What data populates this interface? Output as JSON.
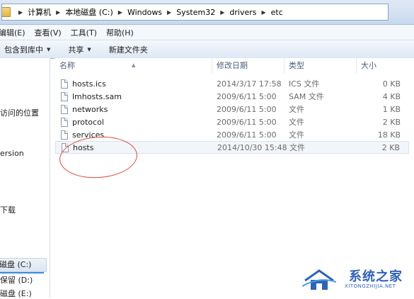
{
  "address": {
    "crumbs": [
      "计算机",
      "本地磁盘 (C:)",
      "Windows",
      "System32",
      "drivers",
      "etc"
    ]
  },
  "menu": {
    "items": [
      "编辑(E)",
      "查看(V)",
      "工具(T)",
      "帮助(H)"
    ]
  },
  "toolbar": {
    "include_library": "包含到库中",
    "share": "共享",
    "new_folder": "新建文件夹"
  },
  "nav": {
    "items": [
      "访问的位置",
      "ersion",
      "下载",
      "磁盘 (C:)",
      "保留 (D:)",
      "磁盘 (E:)"
    ]
  },
  "columns": {
    "name": "名称",
    "date": "修改日期",
    "type": "类型",
    "size": "大小"
  },
  "files": [
    {
      "name": "hosts.ics",
      "date": "2014/3/17 17:58",
      "type": "ICS 文件",
      "size": "0 KB"
    },
    {
      "name": "lmhosts.sam",
      "date": "2009/6/11 5:00",
      "type": "SAM 文件",
      "size": "4 KB"
    },
    {
      "name": "networks",
      "date": "2009/6/11 5:00",
      "type": "文件",
      "size": "1 KB"
    },
    {
      "name": "protocol",
      "date": "2009/6/11 5:00",
      "type": "文件",
      "size": "2 KB"
    },
    {
      "name": "services",
      "date": "2009/6/11 5:00",
      "type": "文件",
      "size": "18 KB"
    },
    {
      "name": "hosts",
      "date": "2014/10/30 15:48",
      "type": "文件",
      "size": "2 KB"
    }
  ],
  "watermark": {
    "title": "系统之家",
    "subtitle": "XITONGZHIJIA.NET"
  },
  "colors": {
    "annotation": "#d9473f",
    "watermark": "#2f63b8"
  }
}
